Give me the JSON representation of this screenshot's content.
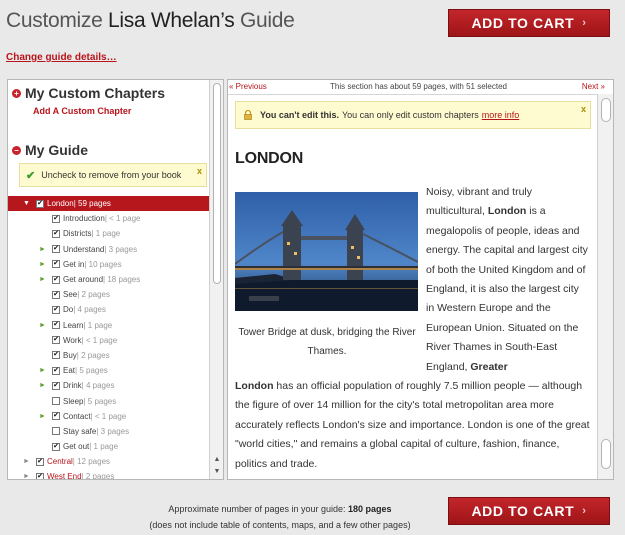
{
  "header": {
    "title_prefix": "Customize ",
    "title_name": "Lisa Whelan’s",
    "title_suffix": " Guide",
    "add_to_cart": "ADD TO CART",
    "arrow": "›",
    "change_link": "Change guide details…"
  },
  "left": {
    "custom_head": "My Custom Chapters",
    "add_custom": "Add A Custom Chapter",
    "guide_head": "My Guide",
    "notice": "Uncheck to remove from your book",
    "notice_close": "x",
    "plus": "+",
    "minus": "−",
    "items": [
      {
        "label": "London",
        "meta": " | 59 pages",
        "level": 0,
        "toggle": "▼",
        "checked": true,
        "selected": true,
        "red": false
      },
      {
        "label": "Introduction",
        "meta": " | < 1 page",
        "level": 1,
        "toggle": "",
        "checked": true,
        "selected": false,
        "red": false
      },
      {
        "label": "Districts",
        "meta": " | 1 page",
        "level": 1,
        "toggle": "",
        "checked": true,
        "selected": false,
        "red": false
      },
      {
        "label": "Understand",
        "meta": " | 3 pages",
        "level": 1,
        "toggle": "►",
        "checked": true,
        "selected": false,
        "red": false
      },
      {
        "label": "Get in",
        "meta": " | 10 pages",
        "level": 1,
        "toggle": "►",
        "checked": true,
        "selected": false,
        "red": false
      },
      {
        "label": "Get around",
        "meta": " | 18 pages",
        "level": 1,
        "toggle": "►",
        "checked": true,
        "selected": false,
        "red": false
      },
      {
        "label": "See",
        "meta": " | 2 pages",
        "level": 1,
        "toggle": "",
        "checked": true,
        "selected": false,
        "red": false
      },
      {
        "label": "Do",
        "meta": " | 4 pages",
        "level": 1,
        "toggle": "",
        "checked": true,
        "selected": false,
        "red": false
      },
      {
        "label": "Learn",
        "meta": " | 1 page",
        "level": 1,
        "toggle": "►",
        "checked": true,
        "selected": false,
        "red": false
      },
      {
        "label": "Work",
        "meta": " | < 1 page",
        "level": 1,
        "toggle": "",
        "checked": true,
        "selected": false,
        "red": false
      },
      {
        "label": "Buy",
        "meta": " | 2 pages",
        "level": 1,
        "toggle": "",
        "checked": true,
        "selected": false,
        "red": false
      },
      {
        "label": "Eat",
        "meta": " | 5 pages",
        "level": 1,
        "toggle": "►",
        "checked": true,
        "selected": false,
        "red": false
      },
      {
        "label": "Drink",
        "meta": " | 4 pages",
        "level": 1,
        "toggle": "►",
        "checked": true,
        "selected": false,
        "red": false
      },
      {
        "label": "Sleep",
        "meta": " | 5 pages",
        "level": 1,
        "toggle": "",
        "checked": false,
        "selected": false,
        "red": false
      },
      {
        "label": "Contact",
        "meta": " | < 1 page",
        "level": 1,
        "toggle": "►",
        "checked": true,
        "selected": false,
        "red": false
      },
      {
        "label": "Stay safe",
        "meta": " | 3 pages",
        "level": 1,
        "toggle": "",
        "checked": false,
        "selected": false,
        "red": false
      },
      {
        "label": "Get out",
        "meta": " | 1 page",
        "level": 1,
        "toggle": "",
        "checked": true,
        "selected": false,
        "red": false
      },
      {
        "label": "Central",
        "meta": " | 12 pages",
        "level": 0,
        "toggle": "►",
        "checked": true,
        "selected": false,
        "red": true
      },
      {
        "label": "West End",
        "meta": " | 2 pages",
        "level": 0,
        "toggle": "►",
        "checked": true,
        "selected": false,
        "red": true
      }
    ],
    "scroll_up": "▲",
    "scroll_down": "▼"
  },
  "right": {
    "prev": "« Previous",
    "section_info": "This section has about 59 pages, with 51 selected",
    "next": "Next »",
    "warn_bold": "You can't edit this.",
    "warn_text": "You can only edit custom chapters",
    "warn_link": "more info",
    "warn_close": "x",
    "article_title": "LONDON",
    "caption": "Tower Bridge at dusk, bridging the River Thames.",
    "p1_a": "Noisy, vibrant and truly multicultural, ",
    "p1_b": "London",
    "p1_c": " is a megalopolis of people, ideas and energy. The capital and largest city of both the United Kingdom and of England, it is also the largest city in Western Europe and the European Union. Situated on the River Thames in South-East England, ",
    "p1_d": "Greater",
    "p2_a": "London",
    "p2_b": " has an official population of roughly 7.5 million people — although the figure of over 14 million for the city's total metropolitan area more accurately reflects London's size and importance. London is one of the great \"world cities,\" and remains a global capital of culture, fashion, finance, politics and trade."
  },
  "footer": {
    "pages_prefix": "Approximate number of pages in your guide: ",
    "pages_value": "180 pages",
    "pages_note": "(does not include table of contents, maps, and a few other pages)"
  },
  "colors": {
    "accent": "#b8141b",
    "notice_bg": "#fffbd0",
    "button_top": "#c3262b",
    "button_bottom": "#9e1417"
  },
  "icons": [
    "plus-circle-icon",
    "minus-circle-icon",
    "check-icon",
    "lock-icon",
    "close-icon",
    "triangle-down-icon",
    "triangle-right-icon",
    "scroll-up-icon",
    "scroll-down-icon"
  ]
}
